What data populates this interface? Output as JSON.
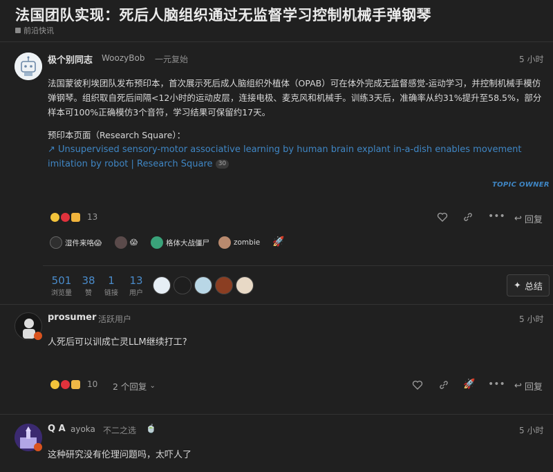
{
  "topic": {
    "title": "法国团队实现：死后人脑组织通过无监督学习控制机械手弹钢琴",
    "category": "前沿快讯"
  },
  "first_post": {
    "username": "极个别同志",
    "handle": "WoozyBob",
    "user_group": "一元复始",
    "time": "5 小时",
    "body": "法国蒙彼利埃团队发布预印本，首次展示死后成人脑组织外植体（OPAB）可在体外完成无监督感觉-运动学习，并控制机械手模仿弹钢琴。组织取自死后间隔<12小时的运动皮层，连接电极、麦克风和机械手。训练3天后，准确率从约31%提升至58.5%，部分样本可100%正确模仿3个音符，学习结果可保留约17天。",
    "preprint_label": "预印本页面（Research Square）：",
    "link_text": "Unsupervised sensory-motor associative learning by human brain explant in-a-dish enables movement imitation by robot | Research Square",
    "link_clicks": "30",
    "topic_owner": "TOPIC OWNER",
    "reaction_count": "13",
    "reply_label": "回复",
    "linked_topics": [
      {
        "label": "湿件来咯😱"
      },
      {
        "label": "😱"
      },
      {
        "label": "格体大战僵尸"
      },
      {
        "label": "zombie"
      }
    ],
    "stats": [
      {
        "value": "501",
        "label": "浏览量"
      },
      {
        "value": "38",
        "label": "赞"
      },
      {
        "value": "1",
        "label": "链接"
      },
      {
        "value": "13",
        "label": "用户"
      }
    ],
    "summary_label": "总结"
  },
  "second_post": {
    "username": "prosumer",
    "user_group": "活跃用户",
    "time": "5 小时",
    "body": "人死后可以训成亡灵LLM继续打工?",
    "reaction_count": "10",
    "replies_toggle": "2 个回复",
    "reply_label": "回复"
  },
  "third_post": {
    "username": "Q A",
    "handle": "ayoka",
    "user_group": "不二之选",
    "time": "5 小时",
    "body": "这种研究没有伦理问题吗，太吓人了"
  },
  "colors": {
    "background": "#202020",
    "link": "#3f86c4",
    "stat_number": "#4a8ccc",
    "like_heart": "#e0323c"
  }
}
